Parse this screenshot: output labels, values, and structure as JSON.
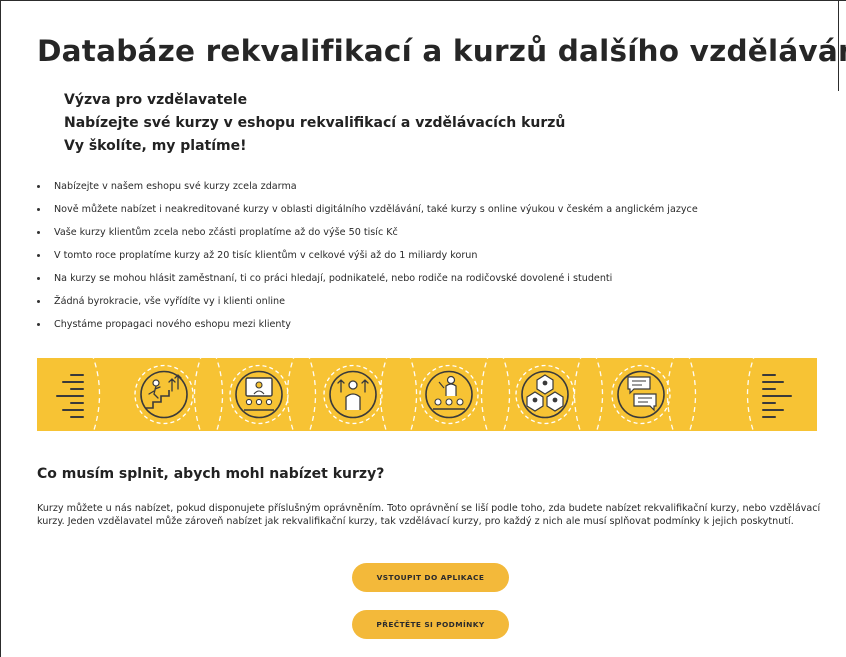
{
  "page": {
    "title": "Databáze rekvalifikací a kurzů dalšího vzdělávání",
    "intro": {
      "line1": "Výzva pro vzdělavatele",
      "line2": "Nabízejte své kurzy v eshopu rekvalifikací a vzdělávacích kurzů",
      "line3": "Vy školíte, my platíme!"
    },
    "bullets": [
      "Nabízejte v našem eshopu své kurzy zcela zdarma",
      "Nově můžete nabízet i neakreditované kurzy v oblasti digitálního vzdělávání, také kurzy s online výukou v českém a anglickém jazyce",
      "Vaše kurzy klientům zcela nebo zčásti proplatíme až do výše 50 tisíc Kč",
      "V tomto roce proplatíme kurzy až 20 tisíc klientům v celkové výši až do 1 miliardy korun",
      "Na kurzy se mohou hlásit zaměstnaní, ti co práci hledají, podnikatelé, nebo rodiče na rodičovské dovolené i studenti",
      "Žádná byrokracie, vše vyřídíte vy i klienti online",
      "Chystáme propagaci nového eshopu mezi klienty"
    ],
    "banner": {
      "background": "#f7c334",
      "icons": [
        "speed-lines-icon",
        "climbing-stairs-icon",
        "online-lecture-icon",
        "growth-person-icon",
        "teacher-class-icon",
        "network-people-icon",
        "chat-bubbles-icon",
        "speed-lines-icon"
      ]
    },
    "section": {
      "heading": "Co musím splnit, abych mohl nabízet kurzy?",
      "body": "Kurzy můžete u nás nabízet, pokud disponujete příslušným oprávněním. Toto oprávnění se liší podle toho, zda budete nabízet rekvalifikační kurzy, nebo vzdělávací kurzy. Jeden vzdělavatel může zároveň nabízet jak rekvalifikační kurzy, tak vzdělávací kurzy, pro každý z nich ale musí splňovat podmínky k jejich poskytnutí."
    },
    "buttons": {
      "enter_app": "VSTOUPIT DO APLIKACE",
      "read_terms": "PŘEČTĚTE SI PODMÍNKY",
      "color": "#f3b93a"
    }
  }
}
